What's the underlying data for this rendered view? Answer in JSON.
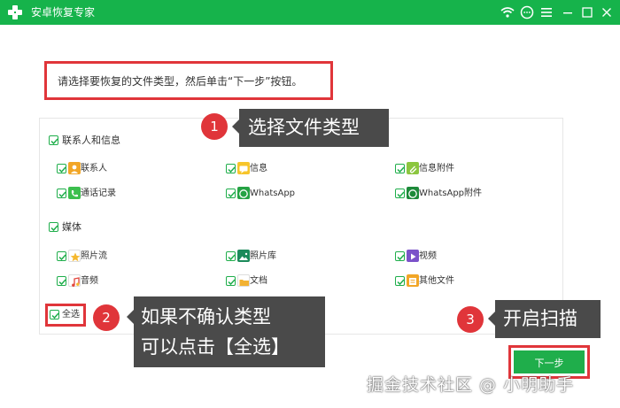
{
  "window": {
    "title": "安卓恢复专家",
    "accent": "#16b34b"
  },
  "instruction": {
    "text": "请选择要恢复的文件类型，然后单击“下一步”按钮。"
  },
  "categories": [
    {
      "label": "联系人和信息",
      "checked": true,
      "items": [
        {
          "label": "联系人",
          "icon": "contact-icon",
          "checked": true
        },
        {
          "label": "信息",
          "icon": "message-icon",
          "checked": true
        },
        {
          "label": "信息附件",
          "icon": "attachment-icon",
          "checked": true
        },
        {
          "label": "通话记录",
          "icon": "phone-icon",
          "checked": true
        },
        {
          "label": "WhatsApp",
          "icon": "whatsapp-icon",
          "checked": true
        },
        {
          "label": "WhatsApp附件",
          "icon": "whatsapp-attachment-icon",
          "checked": true
        }
      ]
    },
    {
      "label": "媒体",
      "checked": true,
      "items": [
        {
          "label": "照片流",
          "icon": "photostream-icon",
          "checked": true
        },
        {
          "label": "照片库",
          "icon": "photo-library-icon",
          "checked": true
        },
        {
          "label": "视频",
          "icon": "video-icon",
          "checked": true
        },
        {
          "label": "音频",
          "icon": "audio-icon",
          "checked": true
        },
        {
          "label": "文档",
          "icon": "document-icon",
          "checked": true
        },
        {
          "label": "其他文件",
          "icon": "other-files-icon",
          "checked": true
        }
      ]
    }
  ],
  "select_all": {
    "label": "全选",
    "checked": true
  },
  "next_button": {
    "label": "下一步"
  },
  "callouts": [
    {
      "number": "1",
      "text": "选择文件类型"
    },
    {
      "number": "2",
      "line1": "如果不确认类型",
      "line2": "可以点击【全选】"
    },
    {
      "number": "3",
      "text": "开启扫描"
    }
  ],
  "watermark": "掘金技术社区 @ 小明助手"
}
